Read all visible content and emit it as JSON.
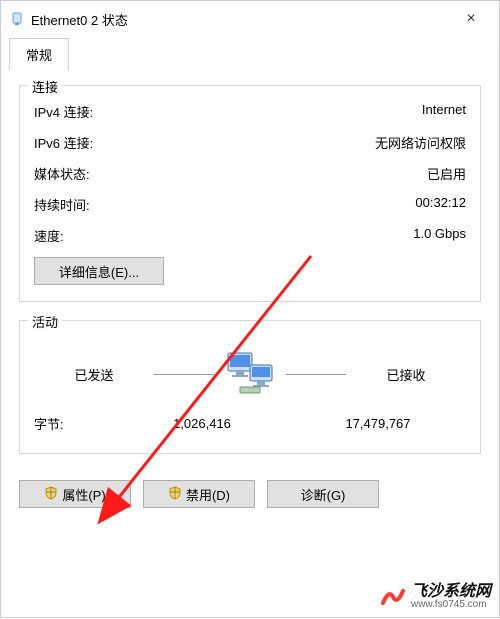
{
  "title": "Ethernet0 2 状态",
  "close_glyph": "×",
  "tab_general": "常规",
  "group_connection": {
    "legend": "连接",
    "ipv4_label": "IPv4 连接:",
    "ipv4_value": "Internet",
    "ipv6_label": "IPv6 连接:",
    "ipv6_value": "无网络访问权限",
    "media_label": "媒体状态:",
    "media_value": "已启用",
    "duration_label": "持续时间:",
    "duration_value": "00:32:12",
    "speed_label": "速度:",
    "speed_value": "1.0 Gbps",
    "details_btn": "详细信息(E)..."
  },
  "group_activity": {
    "legend": "活动",
    "sent_label": "已发送",
    "received_label": "已接收",
    "bytes_label": "字节:",
    "sent_bytes": "1,026,416",
    "received_bytes": "17,479,767"
  },
  "footer": {
    "properties": "属性(P)",
    "disable": "禁用(D)",
    "diagnose": "诊断(G)"
  },
  "watermark": {
    "main": "飞沙系统网",
    "sub": "www.fs0745.com"
  }
}
